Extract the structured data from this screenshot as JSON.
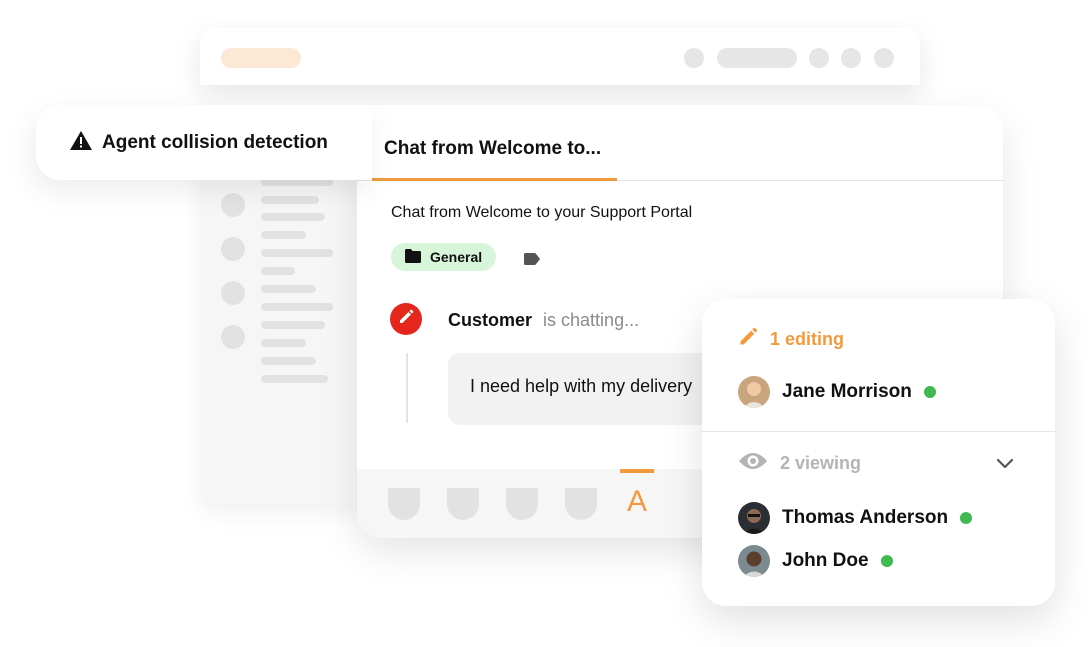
{
  "feature": {
    "title": "Agent collision detection",
    "icon": "warning-icon"
  },
  "tabs": [
    {
      "label": "Chat from Welcome to..."
    }
  ],
  "chat": {
    "title": "Chat from Welcome to your Support Portal",
    "tag": "General",
    "customer_name": "Customer",
    "customer_status": "is chatting...",
    "message": "I need help with my delivery"
  },
  "toolbar": {
    "active_label": "A"
  },
  "presence": {
    "editing": {
      "label": "1 editing",
      "users": [
        {
          "name": "Jane Morrison",
          "status_color": "#3fb950"
        }
      ]
    },
    "viewing": {
      "label": "2 viewing",
      "users": [
        {
          "name": "Thomas Anderson",
          "status_color": "#3fb950"
        },
        {
          "name": "John Doe",
          "status_color": "#3fb950"
        }
      ]
    }
  },
  "colors": {
    "accent": "#f39a3e",
    "danger": "#e4261d",
    "online": "#3fb950",
    "tag_bg": "#d6f5d9"
  }
}
